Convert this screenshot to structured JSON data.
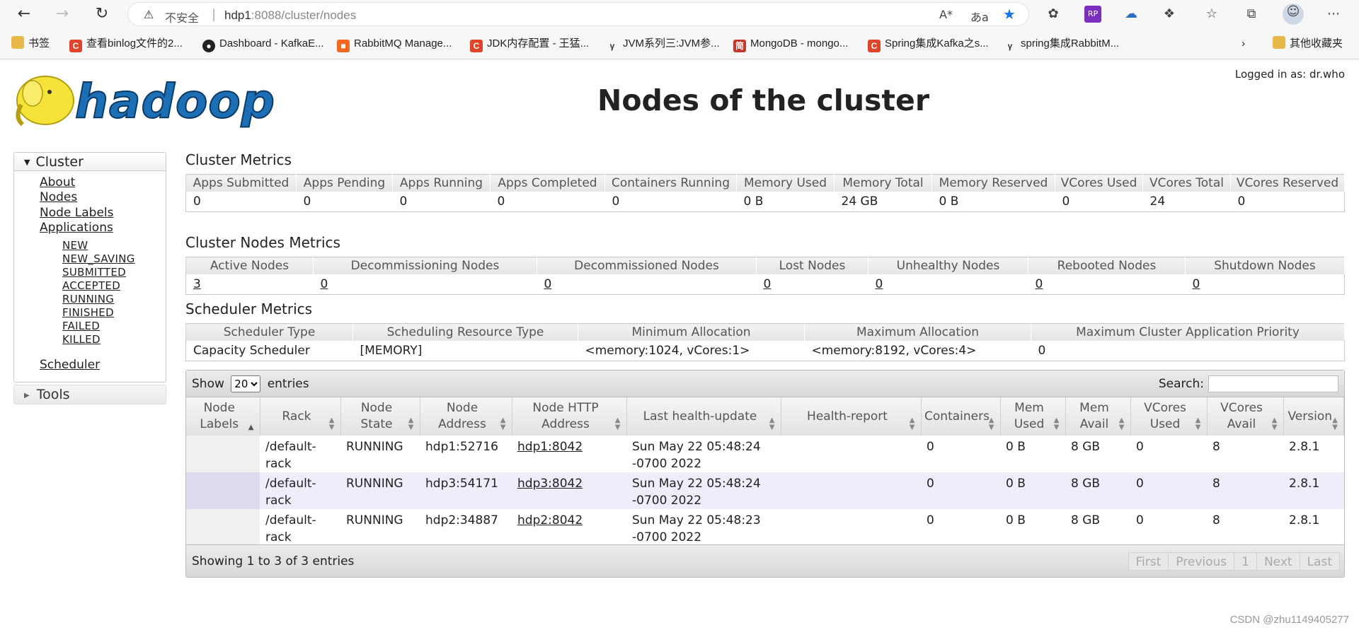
{
  "browser": {
    "insecure_label": "不安全",
    "url_host": "hdp1",
    "url_rest": ":8088/cluster/nodes",
    "bookmarks": [
      {
        "label": "书签",
        "icon": "folder-icon"
      },
      {
        "label": "查看binlog文件的2...",
        "icon": "csdn-icon"
      },
      {
        "label": "Dashboard - KafkaE...",
        "icon": "dashboard-icon"
      },
      {
        "label": "RabbitMQ Manage...",
        "icon": "rabbitmq-icon"
      },
      {
        "label": "JDK内存配置 - 王猛...",
        "icon": "csdn-icon"
      },
      {
        "label": "JVM系列三:JVM参...",
        "icon": "jvm-icon"
      },
      {
        "label": "MongoDB - mongo...",
        "icon": "mongo-icon"
      },
      {
        "label": "Spring集成Kafka之s...",
        "icon": "csdn-icon"
      },
      {
        "label": "spring集成RabbitM...",
        "icon": "jvm-icon"
      }
    ],
    "other_bookmarks": "其他收藏夹"
  },
  "header": {
    "logo_text": "hadoop",
    "logged_in": "Logged in as: dr.who",
    "title": "Nodes of the cluster"
  },
  "sidebar": {
    "cluster_label": "Cluster",
    "links": [
      "About",
      "Nodes",
      "Node Labels",
      "Applications"
    ],
    "app_states": [
      "NEW",
      "NEW_SAVING",
      "SUBMITTED",
      "ACCEPTED",
      "RUNNING",
      "FINISHED",
      "FAILED",
      "KILLED"
    ],
    "scheduler": "Scheduler",
    "tools_label": "Tools"
  },
  "cluster_metrics": {
    "title": "Cluster Metrics",
    "headers": [
      "Apps Submitted",
      "Apps Pending",
      "Apps Running",
      "Apps Completed",
      "Containers Running",
      "Memory Used",
      "Memory Total",
      "Memory Reserved",
      "VCores Used",
      "VCores Total",
      "VCores Reserved"
    ],
    "values": [
      "0",
      "0",
      "0",
      "0",
      "0",
      "0 B",
      "24 GB",
      "0 B",
      "0",
      "24",
      "0"
    ]
  },
  "node_metrics": {
    "title": "Cluster Nodes Metrics",
    "headers": [
      "Active Nodes",
      "Decommissioning Nodes",
      "Decommissioned Nodes",
      "Lost Nodes",
      "Unhealthy Nodes",
      "Rebooted Nodes",
      "Shutdown Nodes"
    ],
    "values": [
      "3",
      "0",
      "0",
      "0",
      "0",
      "0",
      "0"
    ]
  },
  "scheduler_metrics": {
    "title": "Scheduler Metrics",
    "headers": [
      "Scheduler Type",
      "Scheduling Resource Type",
      "Minimum Allocation",
      "Maximum Allocation",
      "Maximum Cluster Application Priority"
    ],
    "values": [
      "Capacity Scheduler",
      "[MEMORY]",
      "<memory:1024, vCores:1>",
      "<memory:8192, vCores:4>",
      "0"
    ]
  },
  "nodes_table": {
    "show_label": "Show",
    "page_size": "20",
    "entries_label": "entries",
    "search_label": "Search:",
    "headers": [
      "Node Labels",
      "Rack",
      "Node State",
      "Node Address",
      "Node HTTP Address",
      "Last health-update",
      "Health-report",
      "Containers",
      "Mem Used",
      "Mem Avail",
      "VCores Used",
      "VCores Avail",
      "Version"
    ],
    "rows": [
      [
        "",
        "/default-rack",
        "RUNNING",
        "hdp1:52716",
        "hdp1:8042",
        "Sun May 22 05:48:24 -0700 2022",
        "",
        "0",
        "0 B",
        "8 GB",
        "0",
        "8",
        "2.8.1"
      ],
      [
        "",
        "/default-rack",
        "RUNNING",
        "hdp3:54171",
        "hdp3:8042",
        "Sun May 22 05:48:24 -0700 2022",
        "",
        "0",
        "0 B",
        "8 GB",
        "0",
        "8",
        "2.8.1"
      ],
      [
        "",
        "/default-rack",
        "RUNNING",
        "hdp2:34887",
        "hdp2:8042",
        "Sun May 22 05:48:23 -0700 2022",
        "",
        "0",
        "0 B",
        "8 GB",
        "0",
        "8",
        "2.8.1"
      ]
    ],
    "info": "Showing 1 to 3 of 3 entries",
    "pager": [
      "First",
      "Previous",
      "1",
      "Next",
      "Last"
    ]
  },
  "watermark": "CSDN @zhu1149405277",
  "colors": {
    "even_row": "#eeeefb",
    "logo_yellow": "#f5e33a",
    "logo_blue": "#1c6fb5"
  }
}
